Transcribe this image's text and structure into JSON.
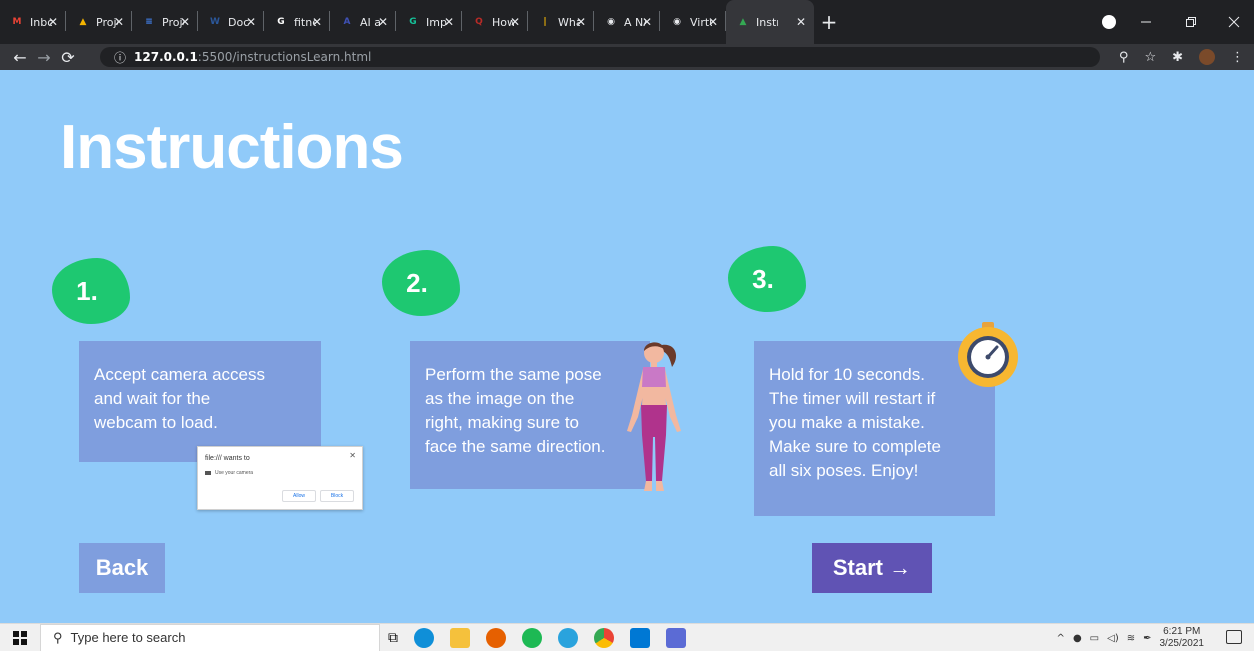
{
  "browser": {
    "tabs": [
      {
        "title": "Inbox",
        "icon": "gmail-icon",
        "color": "#ea4335",
        "glyph": "M"
      },
      {
        "title": "Proje",
        "icon": "google-drive-icon",
        "color": "#f4b400",
        "glyph": "▲"
      },
      {
        "title": "Proje",
        "icon": "google-docs-icon",
        "color": "#4285f4",
        "glyph": "≡"
      },
      {
        "title": "Docu",
        "icon": "word-icon",
        "color": "#2b579a",
        "glyph": "W"
      },
      {
        "title": "fitnes",
        "icon": "google-icon",
        "color": "#ffffff",
        "glyph": "G"
      },
      {
        "title": "AI an",
        "icon": "ai-icon",
        "color": "#3f51b5",
        "glyph": "A"
      },
      {
        "title": "Impl",
        "icon": "grammarly-icon",
        "color": "#15c39a",
        "glyph": "G"
      },
      {
        "title": "How",
        "icon": "quora-icon",
        "color": "#b92b27",
        "glyph": "Q"
      },
      {
        "title": "What",
        "icon": "chart-icon",
        "color": "#fbbc04",
        "glyph": "|"
      },
      {
        "title": "A NA",
        "icon": "globe-icon",
        "color": "#e8eaed",
        "glyph": "◉"
      },
      {
        "title": "Virtu",
        "icon": "globe-icon",
        "color": "#e8eaed",
        "glyph": "◉"
      },
      {
        "title": "Instr",
        "icon": "local-site-icon",
        "color": "#34a853",
        "glyph": "▲"
      }
    ],
    "url_host": "127.0.0.1",
    "url_rest": ":5500/instructionsLearn.html"
  },
  "page": {
    "title": "Instructions",
    "steps": [
      {
        "number": "1.",
        "text": "Accept camera access\nand wait for the\nwebcam to load."
      },
      {
        "number": "2.",
        "text": "Perform the same pose\nas the image on the\nright, making sure to\nface the same direction."
      },
      {
        "number": "3.",
        "text": "Hold for 10 seconds.\nThe timer will restart if\nyou make a mistake.\nMake sure to complete\nall six poses. Enjoy!"
      }
    ],
    "back_label": "Back",
    "start_label": "Start →",
    "popup": {
      "title": "file:/// wants to",
      "row": "Use your camera",
      "allow": "Allow",
      "block": "Block"
    }
  },
  "taskbar": {
    "search_placeholder": "Type here to search",
    "time": "6:21 PM",
    "date": "3/25/2021"
  },
  "colors": {
    "background": "#90caf9",
    "card": "#7f9ede",
    "blob": "#1ec871",
    "start_button": "#6053b4"
  }
}
